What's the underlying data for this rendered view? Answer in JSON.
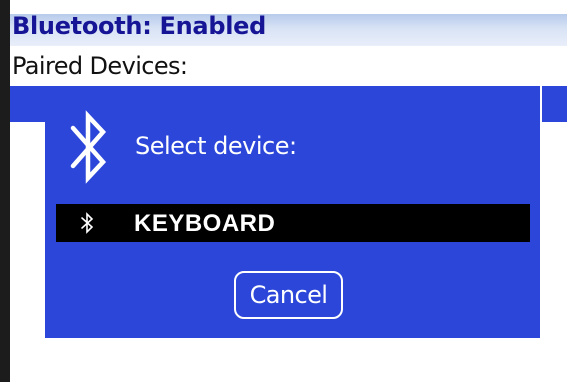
{
  "header": {
    "title": "Bluetooth: Enabled"
  },
  "main": {
    "section_label": "Paired Devices:"
  },
  "dialog": {
    "prompt": "Select device:",
    "icon": "bluetooth-icon",
    "devices": [
      {
        "name": "KEYBOARD",
        "icon": "bluetooth-icon",
        "selected": true
      }
    ],
    "cancel_label": "Cancel"
  },
  "colors": {
    "title_text": "#151596",
    "dialog_background": "#2b46d9",
    "selected_row": "#000000",
    "dialog_text": "#ffffff"
  }
}
